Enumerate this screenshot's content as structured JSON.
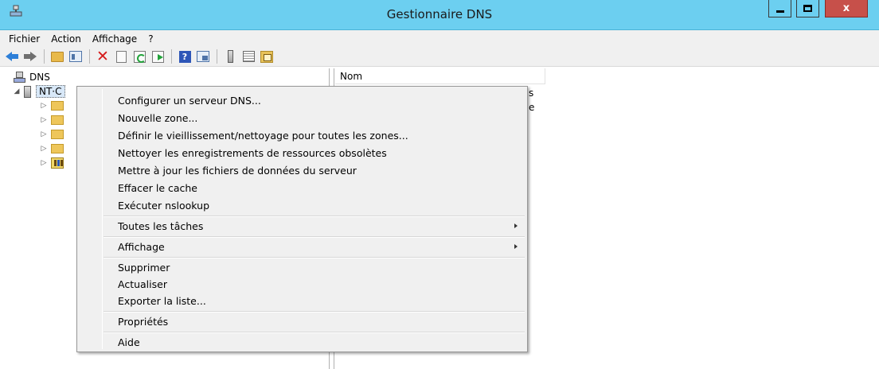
{
  "window": {
    "title": "Gestionnaire DNS",
    "close_label": "x",
    "colors": {
      "titlebar": "#6ccff0",
      "close": "#c7504a",
      "menu_bg": "#f0f0f0"
    }
  },
  "menubar": {
    "items": [
      {
        "label": "Fichier"
      },
      {
        "label": "Action"
      },
      {
        "label": "Affichage"
      },
      {
        "label": "?"
      }
    ]
  },
  "toolbar": {
    "icons": [
      "back-arrow-icon",
      "forward-arrow-icon",
      "up-folder-icon",
      "show-hide-tree-icon",
      "delete-icon",
      "properties-icon",
      "refresh-icon",
      "export-list-icon",
      "help-icon",
      "action-pane-icon",
      "server-icon",
      "list-icon",
      "zone-icon"
    ],
    "help_label": "?"
  },
  "tree": {
    "root_label": "DNS",
    "server_label": "NT·C",
    "expander_open": "◢",
    "expander_closed": "▷"
  },
  "list": {
    "column_name": "Nom",
    "partial_texts": [
      "s",
      "e"
    ]
  },
  "context_menu": {
    "items": [
      {
        "label": "Configurer un serveur DNS..."
      },
      {
        "label": "Nouvelle zone..."
      },
      {
        "label": "Définir le vieillissement/nettoyage pour toutes les zones..."
      },
      {
        "label": "Nettoyer les enregistrements de ressources obsolètes"
      },
      {
        "label": "Mettre à jour les fichiers de données du serveur"
      },
      {
        "label": "Effacer le cache"
      },
      {
        "label": "Exécuter nslookup"
      },
      {
        "label": "Toutes les tâches",
        "submenu": true
      },
      {
        "label": "Affichage",
        "submenu": true
      },
      {
        "label": "Supprimer"
      },
      {
        "label": "Actualiser"
      },
      {
        "label": "Exporter la liste..."
      },
      {
        "label": "Propriétés"
      },
      {
        "label": "Aide"
      }
    ]
  }
}
